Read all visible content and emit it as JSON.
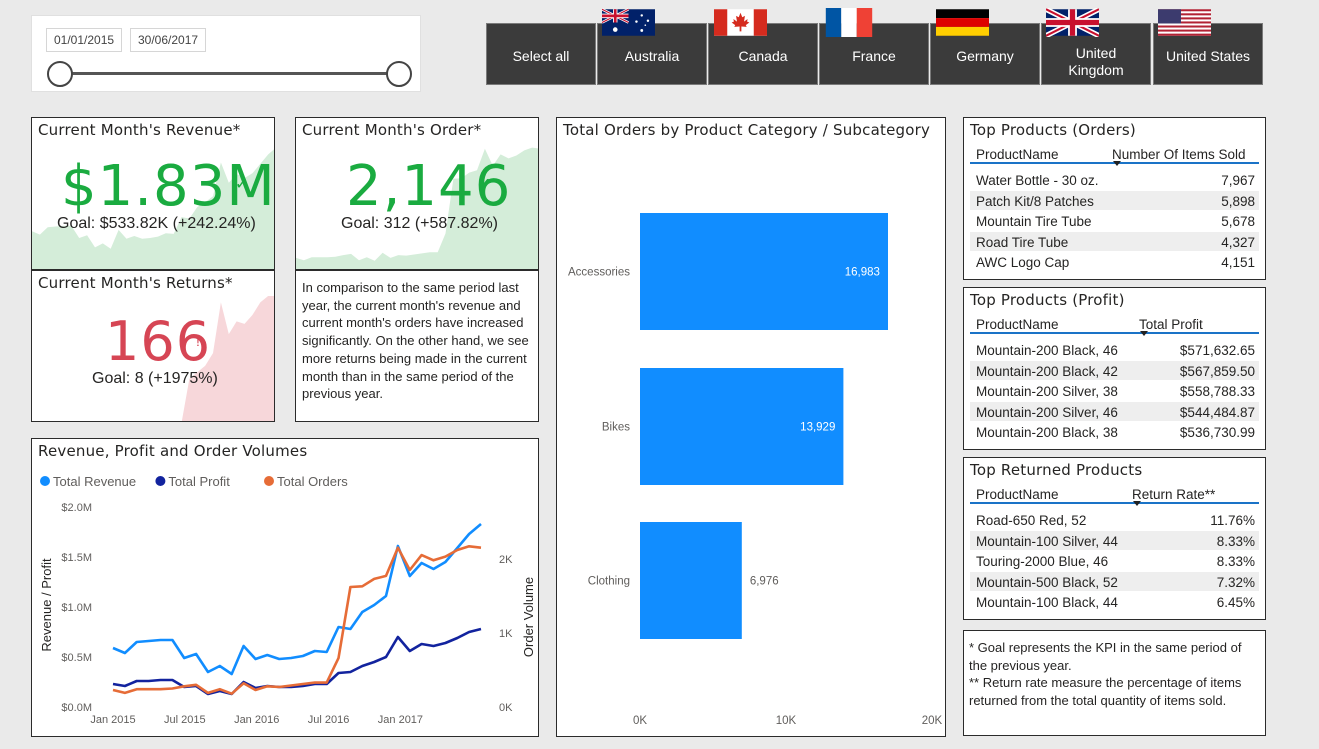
{
  "slicer": {
    "start_date": "01/01/2015",
    "end_date": "30/06/2017",
    "range_fraction": [
      0,
      1
    ]
  },
  "countries": [
    {
      "label": "Select all",
      "flag": null
    },
    {
      "label": "Australia",
      "flag": "australia-flag-icon"
    },
    {
      "label": "Canada",
      "flag": "canada-flag-icon"
    },
    {
      "label": "France",
      "flag": "france-flag-icon"
    },
    {
      "label": "Germany",
      "flag": "germany-flag-icon"
    },
    {
      "label": "United Kingdom",
      "flag": "united-kingdom-flag-icon"
    },
    {
      "label": "United States",
      "flag": "united-states-flag-icon"
    }
  ],
  "kpi_revenue": {
    "title": "Current Month's Revenue*",
    "value": "$1.83M",
    "goal": "Goal: $533.82K (+242.24%)",
    "status_icon": "checkmark-icon",
    "color": "#1aab40",
    "trend_color": "#d4edd9"
  },
  "kpi_orders": {
    "title": "Current Month's Order*",
    "value": "2,146",
    "goal": "Goal: 312 (+587.82%)",
    "status_icon": "checkmark-icon",
    "color": "#1aab40",
    "trend_color": "#d4edd9"
  },
  "kpi_returns": {
    "title": "Current Month's Returns*",
    "value": "166",
    "goal": "Goal: 8 (+1975%)",
    "status_icon": "exclamation-icon",
    "status_mark": "!",
    "color": "#d64554",
    "trend_color": "#f7d7da"
  },
  "commentary": {
    "text": "In comparison to the same period last year, the current month's revenue and current month's orders have increased significantly. On the other hand, we see more returns being made in the current month than in the same period of the previous year."
  },
  "line_chart_title": "Revenue, Profit and Order Volumes",
  "bar_chart_title": "Total Orders by Product Category / Subcategory",
  "chart_data": [
    {
      "type": "line",
      "title": "Revenue, Profit and Order Volumes",
      "xlabel": "",
      "ylabel": "Revenue / Profit",
      "y2label": "Order Volume",
      "x_ticks": [
        "Jan 2015",
        "Jul 2015",
        "Jan 2016",
        "Jul 2016",
        "Jan 2017"
      ],
      "y_ticks": [
        "$0.0M",
        "$0.5M",
        "$1.0M",
        "$1.5M",
        "$2.0M"
      ],
      "y2_ticks": [
        "0K",
        "1K",
        "2K"
      ],
      "ylim": [
        0,
        2.0
      ],
      "y2lim": [
        0,
        2.7
      ],
      "legend_position": "top-left",
      "x": [
        "2015-01",
        "2015-02",
        "2015-03",
        "2015-04",
        "2015-05",
        "2015-06",
        "2015-07",
        "2015-08",
        "2015-09",
        "2015-10",
        "2015-11",
        "2015-12",
        "2016-01",
        "2016-02",
        "2016-03",
        "2016-04",
        "2016-05",
        "2016-06",
        "2016-07",
        "2016-08",
        "2016-09",
        "2016-10",
        "2016-11",
        "2016-12",
        "2017-01",
        "2017-02",
        "2017-03",
        "2017-04",
        "2017-05",
        "2017-06"
      ],
      "series": [
        {
          "name": "Total Revenue",
          "axis": "left",
          "color": "#118dff",
          "values": [
            0.59,
            0.54,
            0.65,
            0.66,
            0.67,
            0.67,
            0.49,
            0.53,
            0.35,
            0.41,
            0.33,
            0.61,
            0.48,
            0.52,
            0.48,
            0.49,
            0.51,
            0.56,
            0.55,
            0.8,
            0.78,
            0.95,
            1.02,
            1.11,
            1.61,
            1.31,
            1.44,
            1.38,
            1.45,
            1.59,
            1.73,
            1.83
          ]
        },
        {
          "name": "Total Profit",
          "axis": "left",
          "color": "#12239e",
          "values": [
            0.23,
            0.21,
            0.26,
            0.26,
            0.27,
            0.27,
            0.2,
            0.21,
            0.13,
            0.16,
            0.13,
            0.25,
            0.19,
            0.21,
            0.2,
            0.2,
            0.21,
            0.23,
            0.23,
            0.34,
            0.35,
            0.41,
            0.45,
            0.5,
            0.7,
            0.56,
            0.63,
            0.61,
            0.64,
            0.69,
            0.75,
            0.78
          ]
        },
        {
          "name": "Total Orders",
          "axis": "right",
          "color": "#e66c37",
          "values": [
            0.23,
            0.19,
            0.24,
            0.24,
            0.24,
            0.25,
            0.28,
            0.3,
            0.19,
            0.24,
            0.18,
            0.32,
            0.23,
            0.28,
            0.27,
            0.29,
            0.31,
            0.33,
            0.33,
            0.66,
            1.62,
            1.63,
            1.73,
            1.77,
            2.15,
            1.85,
            2.05,
            1.98,
            2.03,
            2.12,
            2.17,
            2.15
          ]
        }
      ]
    },
    {
      "type": "bar",
      "orientation": "horizontal",
      "title": "Total Orders by Product Category / Subcategory",
      "categories": [
        "Accessories",
        "Bikes",
        "Clothing"
      ],
      "values": [
        16983,
        13929,
        6976
      ],
      "value_labels": [
        "16,983",
        "13,929",
        "6,976"
      ],
      "x_ticks": [
        "0K",
        "10K",
        "20K"
      ],
      "xlim": [
        0,
        20000
      ],
      "color": "#118dff"
    }
  ],
  "top_orders": {
    "title": "Top Products (Orders)",
    "col1": "ProductName",
    "col2": "Number Of Items Sold",
    "rows": [
      {
        "name": "Water Bottle - 30 oz.",
        "value": "7,967"
      },
      {
        "name": "Patch Kit/8 Patches",
        "value": "5,898"
      },
      {
        "name": "Mountain Tire Tube",
        "value": "5,678"
      },
      {
        "name": "Road Tire Tube",
        "value": "4,327"
      },
      {
        "name": "AWC Logo Cap",
        "value": "4,151"
      }
    ]
  },
  "top_profit": {
    "title": "Top Products (Profit)",
    "col1": "ProductName",
    "col2": "Total Profit",
    "rows": [
      {
        "name": "Mountain-200 Black, 46",
        "value": "$571,632.65"
      },
      {
        "name": "Mountain-200 Black, 42",
        "value": "$567,859.50"
      },
      {
        "name": "Mountain-200 Silver, 38",
        "value": "$558,788.33"
      },
      {
        "name": "Mountain-200 Silver, 46",
        "value": "$544,484.87"
      },
      {
        "name": "Mountain-200 Black, 38",
        "value": "$536,730.99"
      }
    ]
  },
  "top_returned": {
    "title": "Top Returned Products",
    "col1": "ProductName",
    "col2": "Return Rate**",
    "rows": [
      {
        "name": "Road-650 Red, 52",
        "value": "11.76%"
      },
      {
        "name": "Mountain-100 Silver, 44",
        "value": "8.33%"
      },
      {
        "name": "Touring-2000 Blue, 46",
        "value": "8.33%"
      },
      {
        "name": "Mountain-500 Black, 52",
        "value": "7.32%"
      },
      {
        "name": "Mountain-100 Black, 44",
        "value": "6.45%"
      }
    ]
  },
  "footnote": {
    "line1": "* Goal represents the KPI in the same period of the previous year.",
    "line2": "** Return rate measure the percentage of items returned from the total quantity of items sold."
  }
}
